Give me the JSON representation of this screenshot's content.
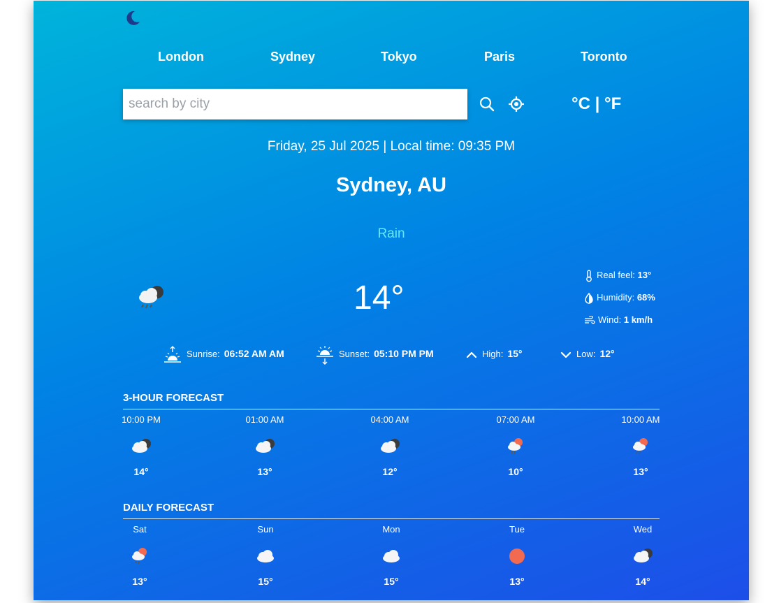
{
  "quick_cities": [
    "London",
    "Sydney",
    "Tokyo",
    "Paris",
    "Toronto"
  ],
  "search": {
    "placeholder": "search by city",
    "value": ""
  },
  "units": {
    "celsius": "°C",
    "separator": "|",
    "fahrenheit": "°F"
  },
  "datetime": "Friday, 25 Jul 2025 | Local time: 09:35 PM",
  "location": "Sydney, AU",
  "condition": "Rain",
  "temperature": "14°",
  "details": {
    "real_feel_label": "Real feel:",
    "real_feel_value": "13°",
    "humidity_label": "Humidity:",
    "humidity_value": "68%",
    "wind_label": "Wind:",
    "wind_value": "1 km/h"
  },
  "sun": {
    "sunrise_label": "Sunrise:",
    "sunrise_value": "06:52 AM AM",
    "sunset_label": "Sunset:",
    "sunset_value": "05:10 PM PM",
    "high_label": "High:",
    "high_value": "15°",
    "low_label": "Low:",
    "low_value": "12°"
  },
  "hourly": {
    "title": "3-hour forecast",
    "items": [
      {
        "label": "10:00 PM",
        "icon": "rain-cloud-night-icon",
        "temp": "14°"
      },
      {
        "label": "01:00 AM",
        "icon": "cloud-night-icon",
        "temp": "13°"
      },
      {
        "label": "04:00 AM",
        "icon": "cloud-night-icon",
        "temp": "12°"
      },
      {
        "label": "07:00 AM",
        "icon": "rain-cloud-sun-icon",
        "temp": "10°"
      },
      {
        "label": "10:00 AM",
        "icon": "rain-cloud-sun-icon",
        "temp": "13°"
      }
    ]
  },
  "daily": {
    "title": "daily forecast",
    "items": [
      {
        "label": "Sat",
        "icon": "rain-cloud-sun-icon",
        "temp": "13°"
      },
      {
        "label": "Sun",
        "icon": "cloud-icon",
        "temp": "15°"
      },
      {
        "label": "Mon",
        "icon": "cloud-icon",
        "temp": "15°"
      },
      {
        "label": "Tue",
        "icon": "sun-icon",
        "temp": "13°"
      },
      {
        "label": "Wed",
        "icon": "cloud-night-icon",
        "temp": "14°"
      }
    ]
  },
  "colors": {
    "condition": "#67e8f9",
    "sun": "#f26a4f",
    "moon": "#1e3a8a"
  }
}
